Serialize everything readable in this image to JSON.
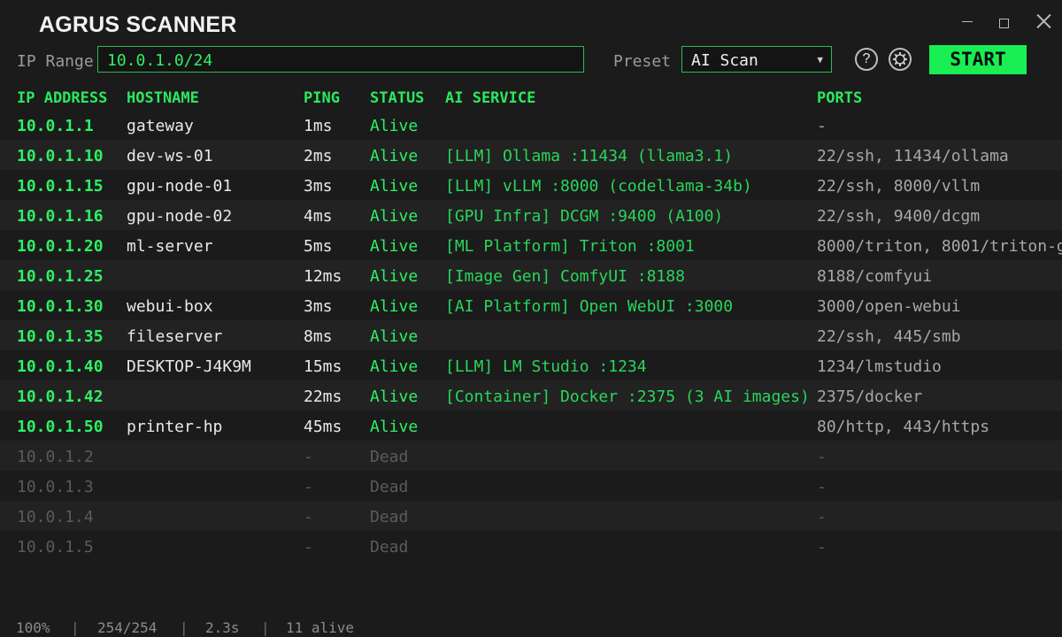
{
  "window": {
    "title": "AGRUS SCANNER"
  },
  "toolbar": {
    "ip_range_label": "IP Range",
    "ip_range_value": "10.0.1.0/24",
    "preset_label": "Preset",
    "preset_value": "AI Scan",
    "help_glyph": "?",
    "start_label": "START"
  },
  "icons": [
    "minimize-icon",
    "maximize-icon",
    "close-icon",
    "help-icon",
    "gear-icon",
    "chevron-down-icon"
  ],
  "colors": {
    "accent": "#19ee52",
    "alive": "#2ef064",
    "dead": "#5b5b5b",
    "background": "#1b1b1b"
  },
  "table": {
    "columns": [
      "IP ADDRESS",
      "HOSTNAME",
      "PING",
      "STATUS",
      "AI SERVICE",
      "PORTS"
    ],
    "rows": [
      {
        "ip": "10.0.1.1",
        "hostname": "gateway",
        "ping": "1ms",
        "status": "Alive",
        "service": "",
        "ports": "-"
      },
      {
        "ip": "10.0.1.10",
        "hostname": "dev-ws-01",
        "ping": "2ms",
        "status": "Alive",
        "service": "[LLM] Ollama :11434 (llama3.1)",
        "ports": "22/ssh, 11434/ollama"
      },
      {
        "ip": "10.0.1.15",
        "hostname": "gpu-node-01",
        "ping": "3ms",
        "status": "Alive",
        "service": "[LLM] vLLM :8000 (codellama-34b)",
        "ports": "22/ssh, 8000/vllm"
      },
      {
        "ip": "10.0.1.16",
        "hostname": "gpu-node-02",
        "ping": "4ms",
        "status": "Alive",
        "service": "[GPU Infra] DCGM :9400 (A100)",
        "ports": "22/ssh, 9400/dcgm"
      },
      {
        "ip": "10.0.1.20",
        "hostname": "ml-server",
        "ping": "5ms",
        "status": "Alive",
        "service": "[ML Platform] Triton :8001",
        "ports": "8000/triton, 8001/triton-g"
      },
      {
        "ip": "10.0.1.25",
        "hostname": "",
        "ping": "12ms",
        "status": "Alive",
        "service": "[Image Gen] ComfyUI :8188",
        "ports": "8188/comfyui"
      },
      {
        "ip": "10.0.1.30",
        "hostname": "webui-box",
        "ping": "3ms",
        "status": "Alive",
        "service": "[AI Platform] Open WebUI :3000",
        "ports": "3000/open-webui"
      },
      {
        "ip": "10.0.1.35",
        "hostname": "fileserver",
        "ping": "8ms",
        "status": "Alive",
        "service": "",
        "ports": "22/ssh, 445/smb"
      },
      {
        "ip": "10.0.1.40",
        "hostname": "DESKTOP-J4K9M",
        "ping": "15ms",
        "status": "Alive",
        "service": "[LLM] LM Studio :1234",
        "ports": "1234/lmstudio"
      },
      {
        "ip": "10.0.1.42",
        "hostname": "",
        "ping": "22ms",
        "status": "Alive",
        "service": "[Container] Docker :2375 (3 AI images)",
        "ports": "2375/docker"
      },
      {
        "ip": "10.0.1.50",
        "hostname": "printer-hp",
        "ping": "45ms",
        "status": "Alive",
        "service": "",
        "ports": "80/http, 443/https"
      },
      {
        "ip": "10.0.1.2",
        "hostname": "",
        "ping": "-",
        "status": "Dead",
        "service": "",
        "ports": "-"
      },
      {
        "ip": "10.0.1.3",
        "hostname": "",
        "ping": "-",
        "status": "Dead",
        "service": "",
        "ports": "-"
      },
      {
        "ip": "10.0.1.4",
        "hostname": "",
        "ping": "-",
        "status": "Dead",
        "service": "",
        "ports": "-"
      },
      {
        "ip": "10.0.1.5",
        "hostname": "",
        "ping": "-",
        "status": "Dead",
        "service": "",
        "ports": "-"
      }
    ]
  },
  "statusbar": {
    "progress": "100%",
    "scanned": "254/254",
    "elapsed": "2.3s",
    "alive": "11 alive",
    "separator": "|"
  }
}
